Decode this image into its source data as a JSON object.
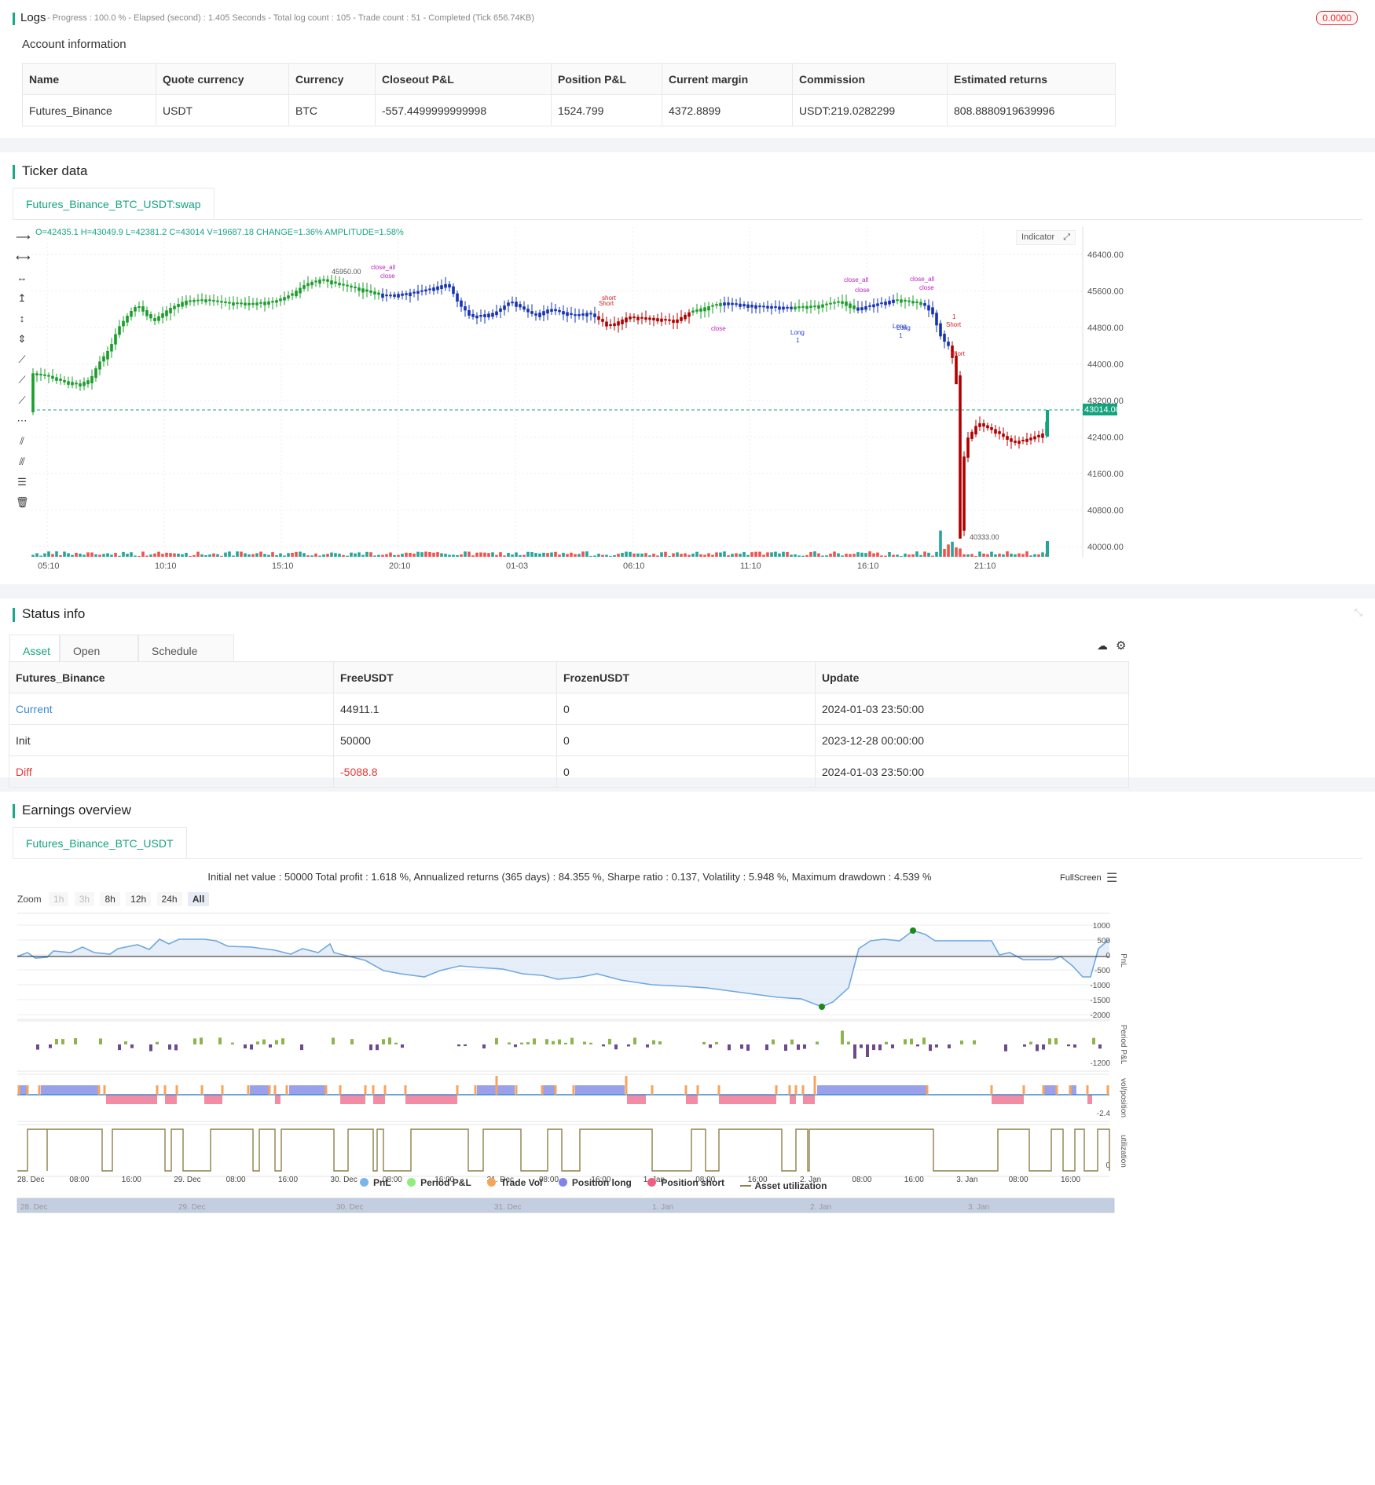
{
  "logs": {
    "title": "Logs",
    "status": "- Progress : 100.0 % - Elapsed (second) : 1.405  Seconds - Total log count : 105 - Trade count : 51 - Completed (Tick 656.74KB)",
    "badge": "0.0000"
  },
  "account": {
    "title": "Account information",
    "headers": [
      "Name",
      "Quote currency",
      "Currency",
      "Closeout P&L",
      "Position P&L",
      "Current margin",
      "Commission",
      "Estimated returns"
    ],
    "row": [
      "Futures_Binance",
      "USDT",
      "BTC",
      "-557.4499999999998",
      "1524.799",
      "4372.8899",
      "USDT:219.0282299",
      "808.8880919639996"
    ]
  },
  "ticker": {
    "title": "Ticker data",
    "tab": "Futures_Binance_BTC_USDT:swap",
    "ohlc": "O=42435.1 H=43049.9 L=42381.2 C=43014 V=19687.18 CHANGE=1.36% AMPLITUDE=1.58%",
    "indicator_btn": "Indicator",
    "price_labels": [
      "46400.00",
      "45600.00",
      "44800.00",
      "44000.00",
      "43200.00",
      "42400.00",
      "41600.00",
      "40800.00",
      "40000.00"
    ],
    "current_price": "43014.00",
    "time_labels": [
      "05:10",
      "10:10",
      "15:10",
      "20:10",
      "01-03",
      "06:10",
      "11:10",
      "16:10",
      "21:10"
    ],
    "high_marker": "45950.00",
    "low_marker": "40333.00",
    "annotations": [
      "close_all",
      "close",
      "short",
      "Short",
      "close_all",
      "close",
      "close",
      "Long",
      "1",
      "Long",
      "close_all",
      "close",
      "Long",
      "1",
      "1",
      "Short",
      "short"
    ]
  },
  "status": {
    "title": "Status info",
    "tabs": [
      "Asset",
      "Open orders",
      "Schedule orders"
    ],
    "headers": [
      "Futures_Binance",
      "FreeUSDT",
      "FrozenUSDT",
      "Update"
    ],
    "rows": [
      [
        "Current",
        "44911.1",
        "0",
        "2024-01-03 23:50:00"
      ],
      [
        "Init",
        "50000",
        "0",
        "2023-12-28 00:00:00"
      ],
      [
        "Diff",
        "-5088.8",
        "0",
        "2024-01-03 23:50:00"
      ]
    ]
  },
  "earnings": {
    "title": "Earnings overview",
    "tab": "Futures_Binance_BTC_USDT",
    "summary": "Initial net value : 50000 Total profit : 1.618 %, Annualized returns (365 days) : 84.355 %, Sharpe ratio : 0.137, Volatility : 5.948 %, Maximum drawdown : 4.539 %",
    "fullscreen": "FullScreen",
    "zoom_label": "Zoom",
    "zoom_buttons": [
      "1h",
      "3h",
      "8h",
      "12h",
      "24h",
      "All"
    ],
    "pnl_axis": [
      "1000",
      "500",
      "0",
      "-500",
      "-1000",
      "-1500",
      "-2000"
    ],
    "axis_titles": [
      "PnL",
      "Period P&L",
      "vol/position",
      "utilization"
    ],
    "period_min": "-1200",
    "vol_min": "-2.4",
    "util_min": "0",
    "x_labels": [
      "28. Dec",
      "08:00",
      "16:00",
      "29. Dec",
      "08:00",
      "16:00",
      "30. Dec",
      "08:00",
      "16:00",
      "31. Dec",
      "08:00",
      "16:00",
      "1. Jan",
      "08:00",
      "16:00",
      "2. Jan",
      "08:00",
      "16:00",
      "3. Jan",
      "08:00",
      "16:00"
    ],
    "nav_labels": [
      "28. Dec",
      "29. Dec",
      "30. Dec",
      "31. Dec",
      "1. Jan",
      "2. Jan",
      "3. Jan"
    ],
    "legend": [
      {
        "label": "PnL",
        "color": "#7cb5ec"
      },
      {
        "label": "Period P&L",
        "color": "#90ed7d"
      },
      {
        "label": "Trade Vol",
        "color": "#f7a35c"
      },
      {
        "label": "Position long",
        "color": "#8085e9"
      },
      {
        "label": "Position short",
        "color": "#f15c80"
      },
      {
        "label": "Asset utilization",
        "color": "#8d8049"
      }
    ]
  },
  "colors": {
    "accent": "#14a37f",
    "up": "#1a9e2a",
    "down": "#c00000",
    "blue": "#1533b3",
    "danger": "#e53935"
  }
}
